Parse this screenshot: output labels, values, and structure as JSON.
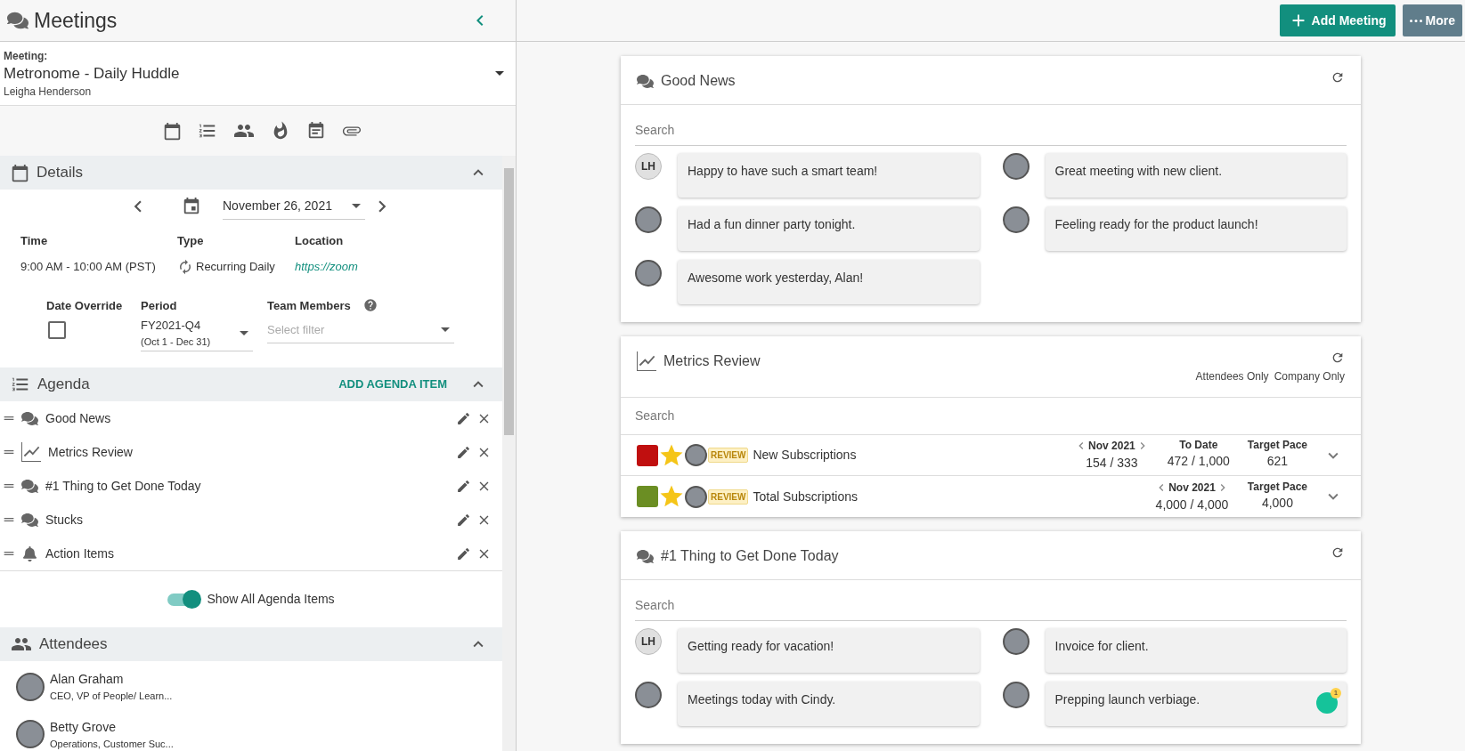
{
  "header": {
    "title": "Meetings"
  },
  "meeting": {
    "label": "Meeting:",
    "name": "Metronome - Daily Huddle",
    "owner": "Leigha Henderson"
  },
  "details": {
    "title": "Details",
    "date": "November 26, 2021",
    "time_label": "Time",
    "time": "9:00 AM - 10:00 AM (PST)",
    "type_label": "Type",
    "type": "Recurring Daily",
    "location_label": "Location",
    "location": "https://zoom",
    "override_label": "Date Override",
    "override_checked": false,
    "period_label": "Period",
    "period": "FY2021-Q4",
    "period_range": "(Oct 1 - Dec 31)",
    "team_label": "Team Members",
    "team_placeholder": "Select filter"
  },
  "agenda": {
    "title": "Agenda",
    "add": "ADD AGENDA ITEM",
    "items": [
      {
        "label": "Good News",
        "kind": "chat"
      },
      {
        "label": "Metrics Review",
        "kind": "chart"
      },
      {
        "label": "#1 Thing to Get Done Today",
        "kind": "chat"
      },
      {
        "label": "Stucks",
        "kind": "chat"
      },
      {
        "label": "Action Items",
        "kind": "bell"
      }
    ],
    "toggle": {
      "label": "Show All Agenda Items",
      "on": true
    }
  },
  "attendees": {
    "title": "Attendees",
    "people": [
      {
        "name": "Alan Graham",
        "role": "CEO, VP of People/ Learn..."
      },
      {
        "name": "Betty Grove",
        "role": "Operations, Customer Suc..."
      }
    ]
  },
  "actions": {
    "add": "Add Meeting",
    "more": "More"
  },
  "good_news": {
    "title": "Good News",
    "search_placeholder": "Search",
    "posts": [
      {
        "initials": "LH",
        "text": "Happy to have such a smart team!"
      },
      {
        "text": "Great meeting with new client."
      },
      {
        "text": "Had a fun dinner party tonight."
      },
      {
        "text": "Feeling ready for the product launch!"
      },
      {
        "text": "Awesome work yesterday, Alan!"
      }
    ]
  },
  "metrics": {
    "title": "Metrics Review",
    "filters": [
      "Attendees Only",
      "Company Only"
    ],
    "search_placeholder": "Search",
    "rows": [
      {
        "color": "#c00f0f",
        "starred": true,
        "tag": "REVIEW",
        "name": "New Subscriptions",
        "stats": [
          {
            "kind": "period",
            "label": "Nov 2021",
            "value": "154 / 333"
          },
          {
            "kind": "plain",
            "label": "To Date",
            "value": "472 / 1,000"
          },
          {
            "kind": "plain",
            "label": "Target Pace",
            "value": "621"
          }
        ]
      },
      {
        "color": "#6b8e23",
        "starred": true,
        "tag": "REVIEW",
        "name": "Total Subscriptions",
        "stats": [
          {
            "kind": "period",
            "label": "Nov 2021",
            "value": "4,000 / 4,000"
          },
          {
            "kind": "plain",
            "label": "Target Pace",
            "value": "4,000"
          }
        ]
      }
    ]
  },
  "thing_today": {
    "title": "#1 Thing to Get Done Today",
    "search_placeholder": "Search",
    "posts": [
      {
        "initials": "LH",
        "text": "Getting ready for vacation!"
      },
      {
        "text": "Invoice for client."
      },
      {
        "text": "Meetings today with Cindy."
      },
      {
        "text": "Prepping launch verbiage.",
        "extension_badge": "1"
      }
    ]
  }
}
